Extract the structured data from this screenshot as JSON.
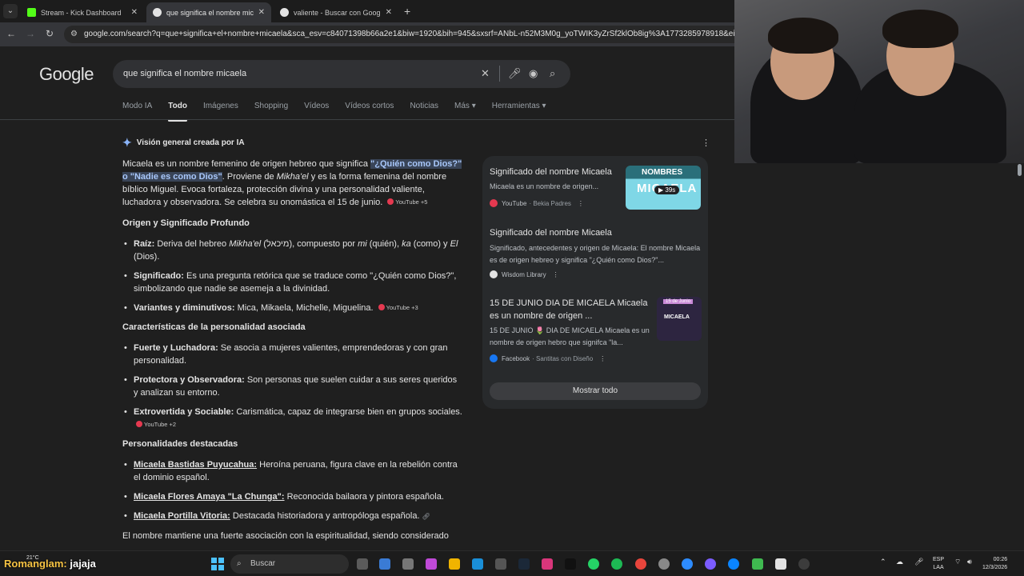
{
  "browser": {
    "tabs": [
      {
        "title": "Stream - Kick Dashboard",
        "favicon_color": "#53fc18",
        "active": false
      },
      {
        "title": "que significa el nombre micaela",
        "favicon_color": "#e3e3e3",
        "active": true
      },
      {
        "title": "valiente - Buscar con Google",
        "favicon_color": "#e3e3e3",
        "active": false
      }
    ],
    "url": "google.com/search?q=que+significa+el+nombre+micaela&sca_esv=c84071398b66a2e1&biw=1920&bih=945&sxsrf=ANbL-n52M3M0g_yoTWIK3yZrSf2klOb8ig%3A1773285978918&ei=WjKyadLfN6"
  },
  "google": {
    "logo": "Google",
    "query": "que significa el nombre micaela",
    "tabs": [
      "Modo IA",
      "Todo",
      "Imágenes",
      "Shopping",
      "Vídeos",
      "Vídeos cortos",
      "Noticias",
      "Más",
      "Herramientas"
    ],
    "active_tab": "Todo"
  },
  "ai_overview": {
    "heading": "Visión general creada por IA",
    "intro": {
      "p1": "Micaela es un nombre femenino de origen hebreo que significa ",
      "hl1": "\"¿Quién como Dios?\"",
      "p2": " ",
      "hl2": "o \"Nadie es como Dios\"",
      "p3": ". Proviene de ",
      "it1": "Mikha'el",
      "p4": " y es la forma femenina del nombre bíblico Miguel. Evoca fortaleza, protección divina y una personalidad valiente, luchadora y observadora. Se celebra su onomástica el 15 de junio.",
      "chip": "YouTube +5"
    },
    "section1": {
      "heading": "Origen y Significado Profundo",
      "raiz_label": "Raíz:",
      "raiz_a": " Deriva del hebreo ",
      "raiz_it": "Mikha'el",
      "raiz_b": " (מיכאל), compuesto por ",
      "raiz_mi": "mi",
      "raiz_c": " (quién), ",
      "raiz_ka": "ka",
      "raiz_d": " (como) y ",
      "raiz_el": "El",
      "raiz_e": " (Dios).",
      "sig_label": "Significado:",
      "sig_text": " Es una pregunta retórica que se traduce como \"¿Quién como Dios?\", simbolizando que nadie se asemeja a la divinidad.",
      "var_label": "Variantes y diminutivos:",
      "var_text": " Mica, Mikaela, Michelle, Miguelina.",
      "var_chip": "YouTube +3"
    },
    "section2": {
      "heading": "Características de la personalidad asociada",
      "i1_label": "Fuerte y Luchadora:",
      "i1_text": " Se asocia a mujeres valientes, emprendedoras y con gran personalidad.",
      "i2_label": "Protectora y Observadora:",
      "i2_text": " Son personas que suelen cuidar a sus seres queridos y analizan su entorno.",
      "i3_label": "Extrovertida y Sociable:",
      "i3_text": " Carismática, capaz de integrarse bien en grupos sociales.",
      "i3_chip": "YouTube +2"
    },
    "section3": {
      "heading": "Personalidades destacadas",
      "p1_label": "Micaela Bastidas Puyucahua:",
      "p1_text": " Heroína peruana, figura clave en la rebelión contra el dominio español.",
      "p2_label": "Micaela Flores Amaya \"La Chunga\":",
      "p2_text": " Reconocida bailaora y pintora española.",
      "p3_label": "Micaela Portilla Vitoria:",
      "p3_text": " Destacada historiadora y antropóloga española."
    },
    "closing": "El nombre mantiene una fuerte asociación con la espiritualidad, siendo considerado"
  },
  "sources": {
    "items": [
      {
        "title": "Significado del nombre Micaela",
        "snippet": "Micaela es un nombre de origen...",
        "site": "YouTube",
        "sub": "· Bekia Padres",
        "dot_color": "#e53950",
        "thumb_top": "NOMBRES",
        "thumb_main": "MICAELA",
        "duration": "▶ 39s"
      },
      {
        "title": "Significado del nombre Micaela",
        "snippet": "Significado, antecedentes y origen de Micaela: El nombre Micaela es de origen hebreo y significa \"¿Quién como Dios?\"...",
        "site": "Wisdom Library",
        "sub": "",
        "dot_color": "#e3e3e3"
      },
      {
        "title": "15 DE JUNIO DIA DE MICAELA Micaela es un nombre de origen ...",
        "snippet": "15 DE JUNIO 🌷 DIA DE MICAELA Micaela es un nombre de origen hebro que signifca \"la...",
        "site": "Facebook",
        "sub": "· Santitas con Diseño",
        "dot_color": "#1877f2",
        "thumb_top": "15 de Junio",
        "thumb_main": "MICAELA"
      }
    ],
    "show_all": "Mostrar todo"
  },
  "stream_overlay": {
    "chat_user": "Romanglam:",
    "chat_message": " jajaja"
  },
  "taskbar": {
    "weather": "21°C",
    "search_placeholder": "Buscar",
    "lang_top": "ESP",
    "lang_bottom": "LAA",
    "time": "00:26",
    "date": "12/3/2026"
  }
}
